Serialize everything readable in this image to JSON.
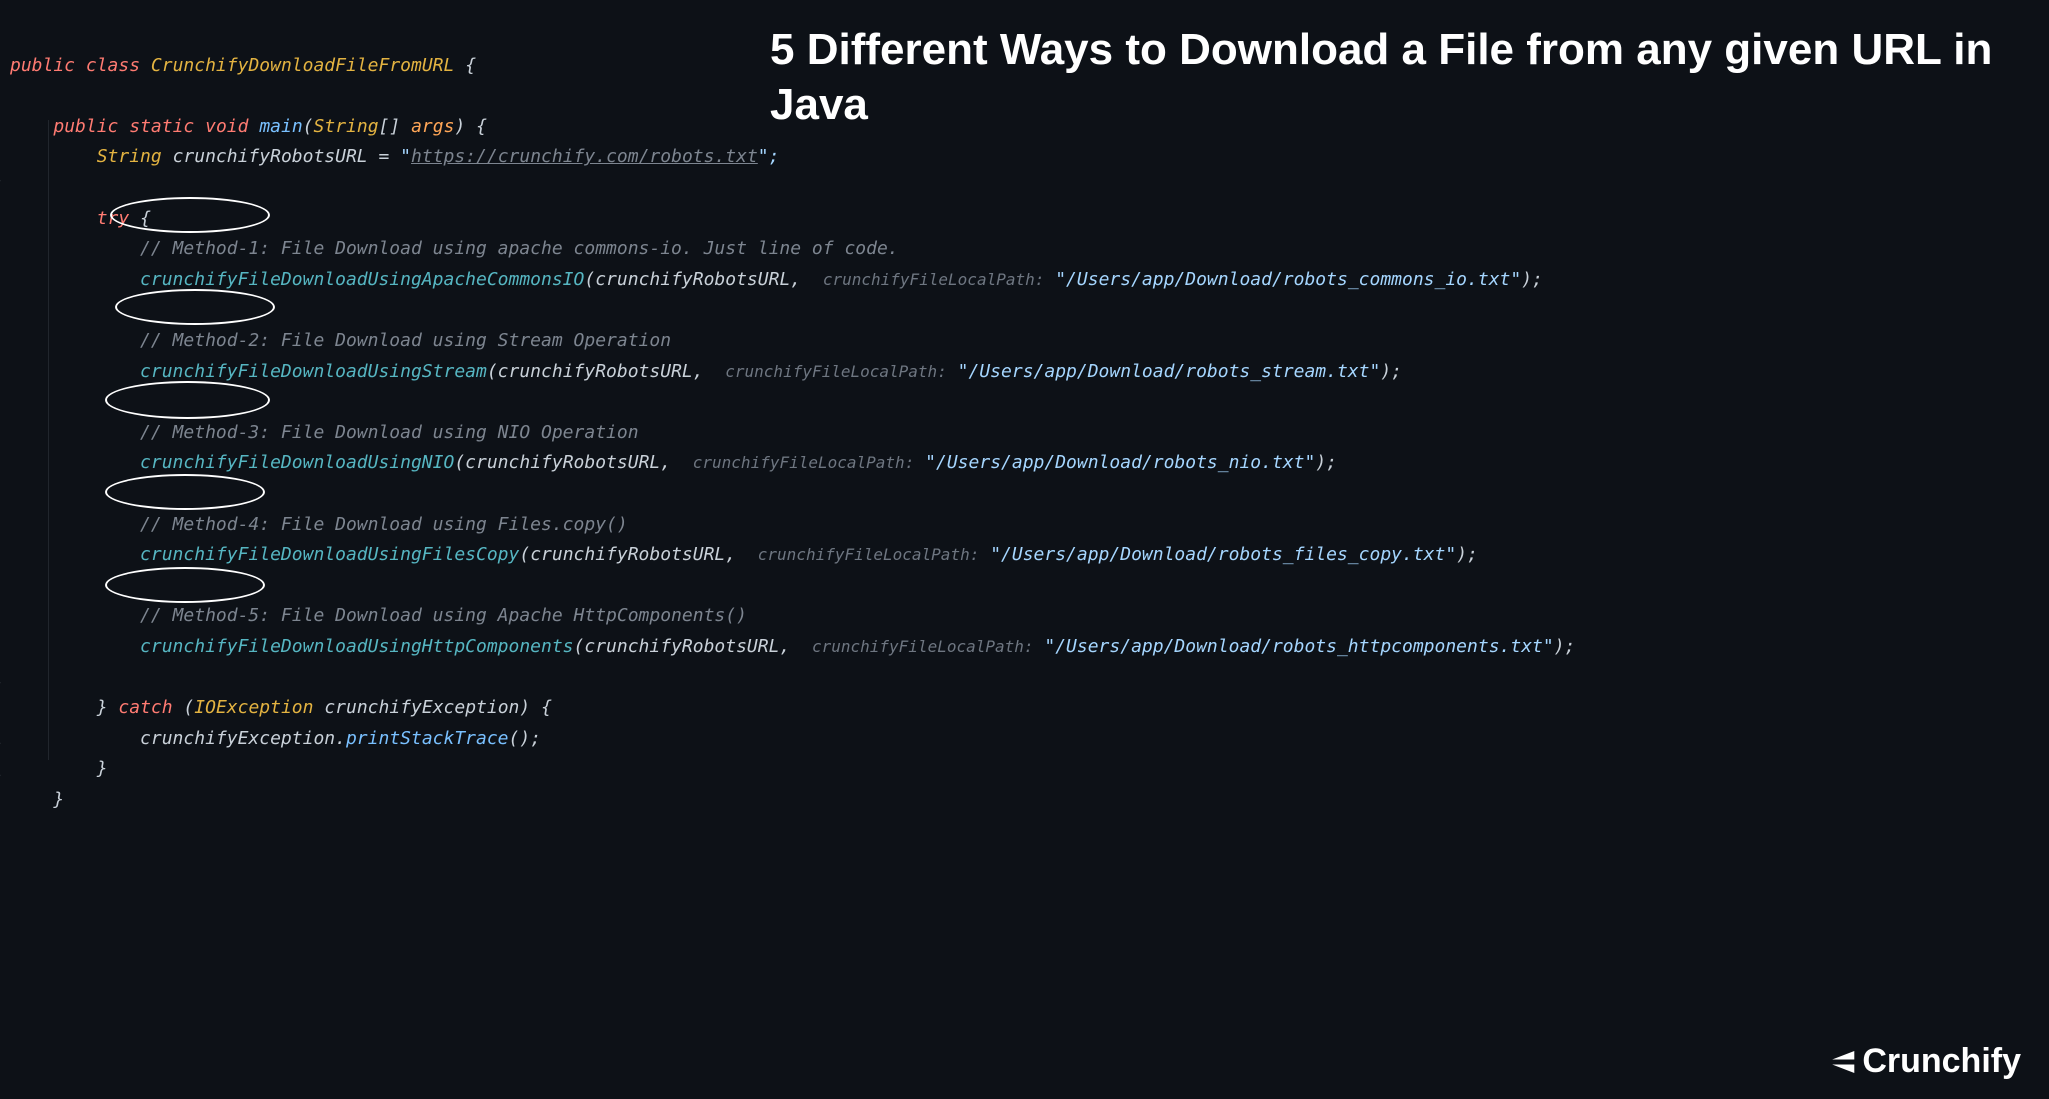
{
  "title": "5 Different Ways to Download a File from any given URL in Java",
  "brand": "Crunchify",
  "code": {
    "classDecl": {
      "publicKw": "public",
      "classKw": "class",
      "className": "CrunchifyDownloadFileFromURL"
    },
    "mainDecl": {
      "publicKw": "public",
      "staticKw": "static",
      "voidKw": "void",
      "method": "main",
      "paramType": "String",
      "paramName": "args"
    },
    "urlLine": {
      "type": "String",
      "varName": "crunchifyRobotsURL",
      "equals": " = ",
      "q1": "\"",
      "url": "https://crunchify.com/robots.txt",
      "q2": "\";"
    },
    "tryKw": "try",
    "catchKw": "catch",
    "catchType": "IOException",
    "catchVar": "crunchifyException",
    "stackTrace": {
      "obj": "crunchifyException",
      "method": "printStackTrace"
    },
    "paramHint": "crunchifyFileLocalPath:",
    "urlArg": "crunchifyRobotsURL",
    "methods": [
      {
        "comment": "// Method-1: File Download using apache commons-io. Just line of code.",
        "call": "crunchifyFileDownloadUsingApacheCommonsIO",
        "path": "\"/Users/app/Download/robots_commons_io.txt\""
      },
      {
        "comment": "// Method-2: File Download using Stream Operation",
        "call": "crunchifyFileDownloadUsingStream",
        "path": "\"/Users/app/Download/robots_stream.txt\""
      },
      {
        "comment": "// Method-3: File Download using NIO Operation",
        "call": "crunchifyFileDownloadUsingNIO",
        "path": "\"/Users/app/Download/robots_nio.txt\""
      },
      {
        "comment": "// Method-4: File Download using Files.copy()",
        "call": "crunchifyFileDownloadUsingFilesCopy",
        "path": "\"/Users/app/Download/robots_files_copy.txt\""
      },
      {
        "comment": "// Method-5: File Download using Apache HttpComponents()",
        "call": "crunchifyFileDownloadUsingHttpComponents",
        "path": "\"/Users/app/Download/robots_httpcomponents.txt\""
      }
    ]
  }
}
